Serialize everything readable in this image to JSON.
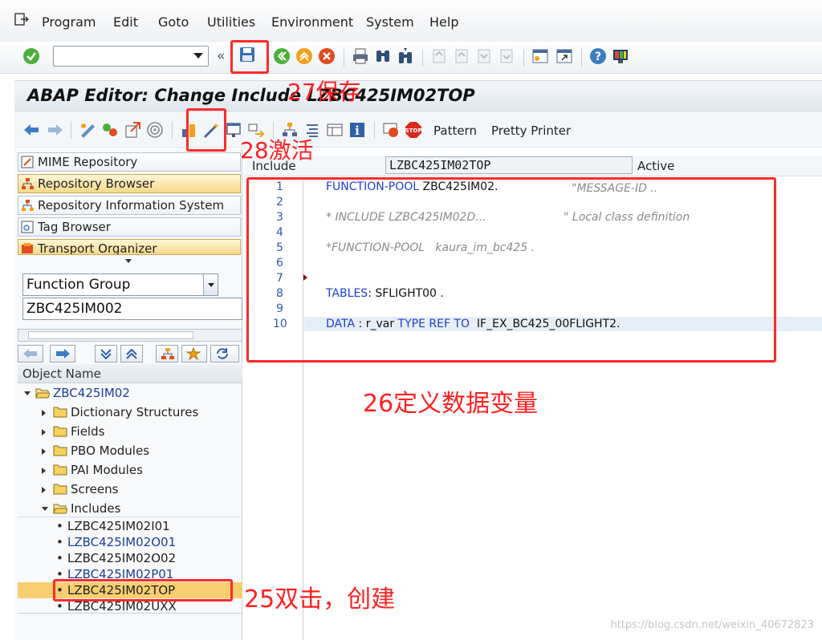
{
  "menubar": {
    "items": [
      "Program",
      "Edit",
      "Goto",
      "Utilities",
      "Environment",
      "System",
      "Help"
    ]
  },
  "title": "ABAP Editor: Change Include LZBC425IM02TOP",
  "app_toolbar": {
    "pattern_label": "Pattern",
    "pretty_printer_label": "Pretty Printer"
  },
  "repository": {
    "buttons": [
      "MIME Repository",
      "Repository Browser",
      "Repository Information System",
      "Tag Browser",
      "Transport Organizer"
    ]
  },
  "browser": {
    "object_type": "Function Group",
    "object_name": "ZBC425IM002",
    "column_header": "Object Name",
    "root": "ZBC425IM02",
    "folders": [
      "Dictionary Structures",
      "Fields",
      "PBO Modules",
      "PAI Modules",
      "Screens",
      "Includes"
    ],
    "includes": [
      "LZBC425IM02I01",
      "LZBC425IM02O01",
      "LZBC425IM02O02",
      "LZBC425IM02P01",
      "LZBC425IM02TOP",
      "LZBC425IM02UXX"
    ]
  },
  "editor": {
    "include_label": "Include",
    "include_name": "LZBC425IM02TOP",
    "status": "Active",
    "line_numbers": [
      "1",
      "2",
      "3",
      "4",
      "5",
      "6",
      "7",
      "8",
      "9",
      "10"
    ],
    "lines": {
      "l1_kw": "FUNCTION-POOL",
      "l1_rest": " ZBC425IM02.",
      "l1_comment": "\"MESSAGE-ID ..",
      "l3_comment": "* INCLUDE LZBC425IM02D...",
      "l3_comment2": "\" Local class definition",
      "l5_comment": "*FUNCTION-POOL   kaura_im_bc425 .",
      "l8_kw": "TABLES",
      "l8_rest": ": SFLIGHT00 .",
      "l10_kw": "DATA",
      "l10_mid": " : r_var ",
      "l10_kw2": "TYPE REF TO",
      "l10_rest": "  IF_EX_BC425_00FLIGHT2."
    }
  },
  "annotations": {
    "save": "27保存",
    "activate": "28激活",
    "define": "26定义数据变量",
    "create": "25双击，创建"
  },
  "watermark": "https://blog.csdn.net/weixin_40672823",
  "colors": {
    "annotation": "#ff2020",
    "keyword": "#1e3fd0",
    "comment": "#8a8a8a",
    "repo_button": "#f5d98a",
    "selected_include": "#f8cf70"
  }
}
